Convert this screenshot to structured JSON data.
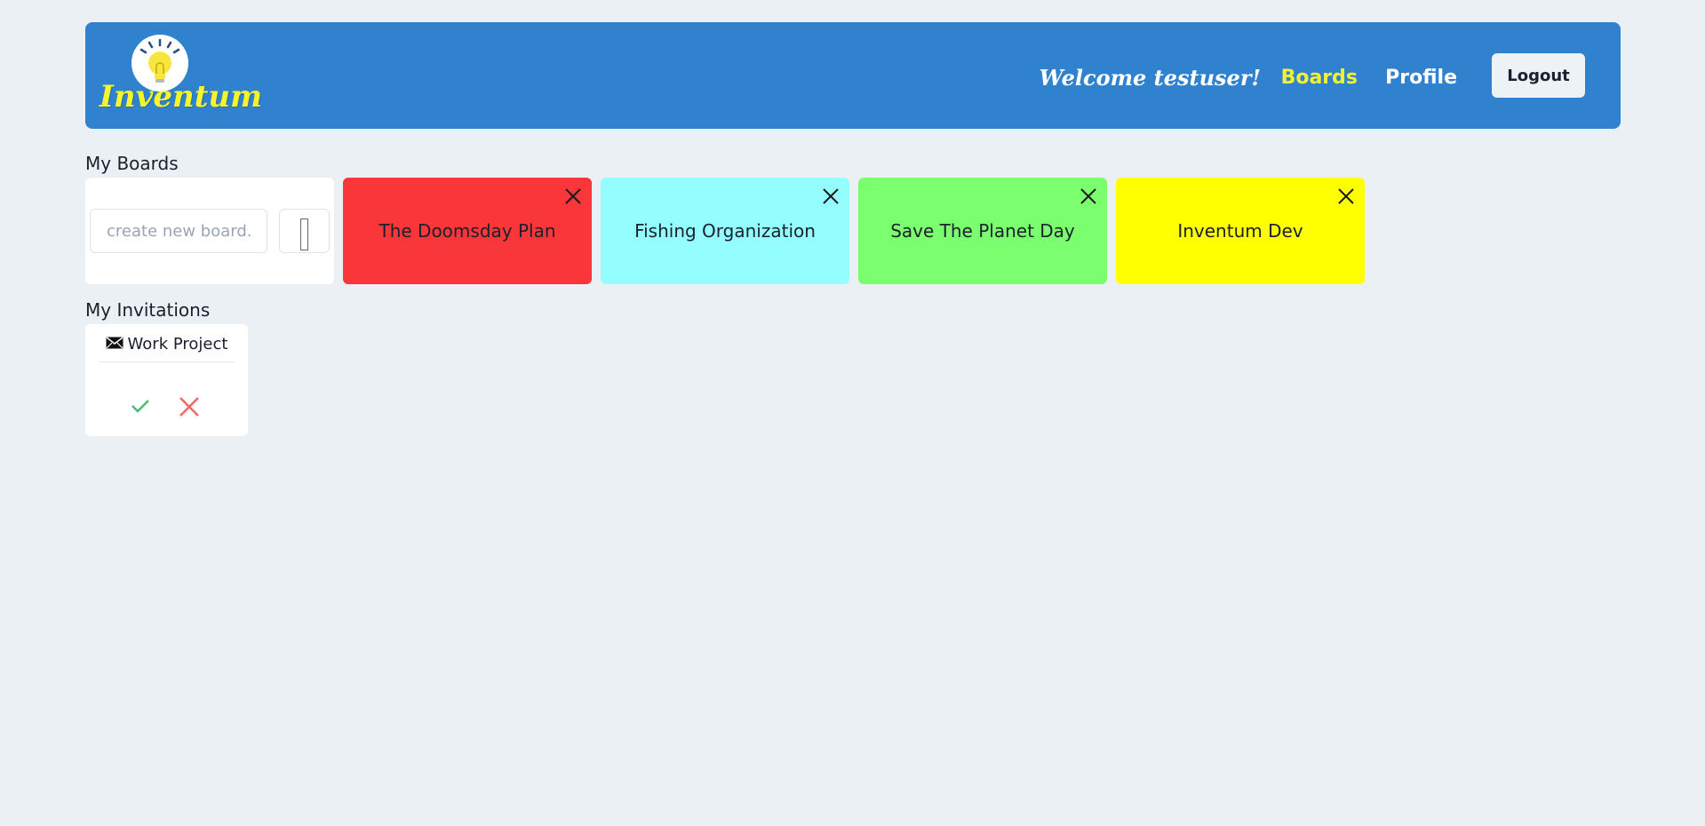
{
  "header": {
    "logo_text": "Inventum",
    "welcome": "Welcome testuser!",
    "nav": {
      "boards": "Boards",
      "profile": "Profile"
    },
    "logout_label": "Logout"
  },
  "boards_section": {
    "title": "My Boards",
    "create_placeholder": "create new board..",
    "boards": [
      {
        "title": "The Doomsday Plan",
        "color": "#f9373b"
      },
      {
        "title": "Fishing Organization",
        "color": "#94feff"
      },
      {
        "title": "Save The Planet Day",
        "color": "#7bff6e"
      },
      {
        "title": "Inventum Dev",
        "color": "#ffff00"
      }
    ]
  },
  "invitations_section": {
    "title": "My Invitations",
    "invitations": [
      {
        "board": "Work Project"
      }
    ]
  },
  "colors": {
    "navbar": "#3182ce",
    "accent_link": "#f2f230",
    "accept": "#48bb78",
    "decline": "#f56565"
  },
  "icons": [
    "lightbulb-logo-icon",
    "close-icon",
    "plus-glyph-icon",
    "envelope-icon",
    "check-icon",
    "x-icon"
  ]
}
